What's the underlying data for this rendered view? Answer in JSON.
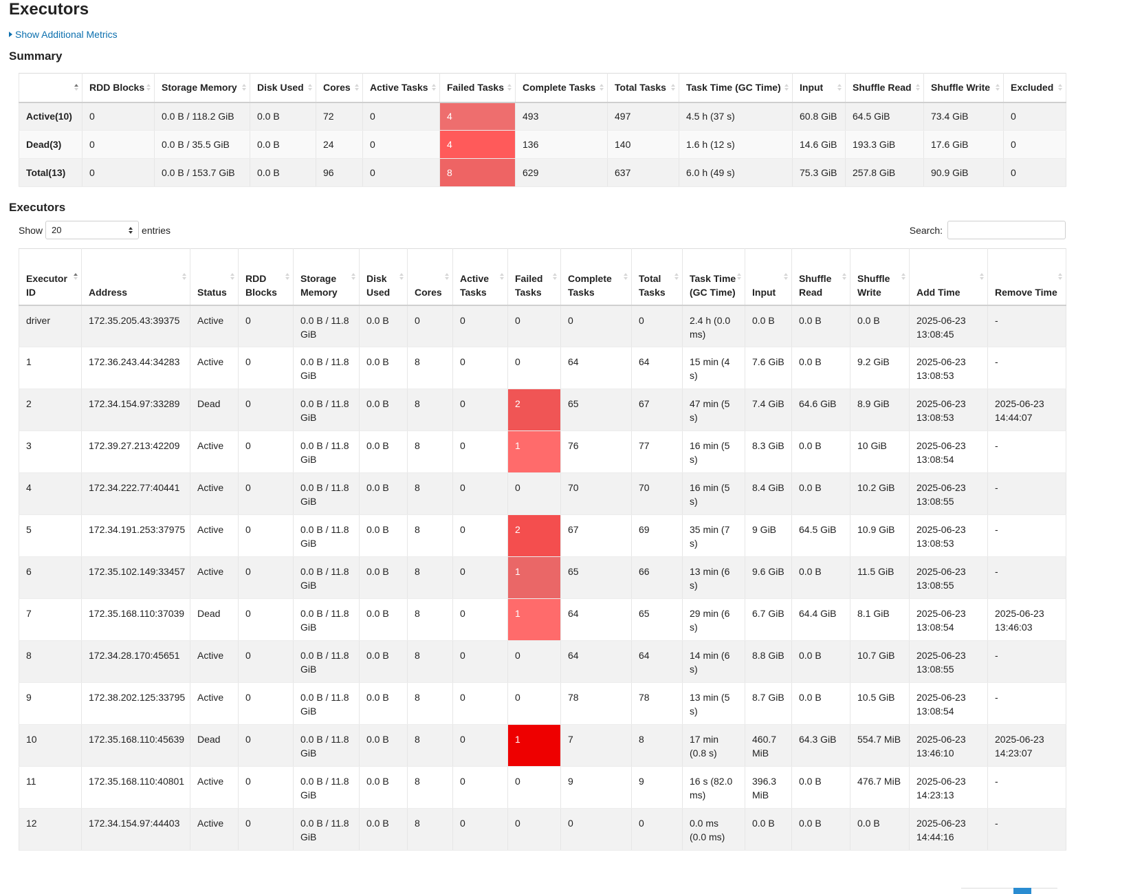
{
  "page": {
    "title": "Executors",
    "toggle_label": "Show Additional Metrics",
    "summary_title": "Summary",
    "executors_title": "Executors"
  },
  "summary": {
    "columns": [
      "",
      "RDD Blocks",
      "Storage Memory",
      "Disk Used",
      "Cores",
      "Active Tasks",
      "Failed Tasks",
      "Complete Tasks",
      "Total Tasks",
      "Task Time (GC Time)",
      "Input",
      "Shuffle Read",
      "Shuffle Write",
      "Excluded"
    ],
    "rows": [
      {
        "label": "Active(10)",
        "rdd": "0",
        "storage": "0.0 B / 118.2 GiB",
        "disk": "0.0 B",
        "cores": "72",
        "active": "0",
        "failed": "4",
        "failed_color": "#ee6e6e",
        "complete": "493",
        "total": "497",
        "task_time": "4.5 h (37 s)",
        "input": "60.8 GiB",
        "shuffle_read": "64.5 GiB",
        "shuffle_write": "73.4 GiB",
        "excluded": "0"
      },
      {
        "label": "Dead(3)",
        "rdd": "0",
        "storage": "0.0 B / 35.5 GiB",
        "disk": "0.0 B",
        "cores": "24",
        "active": "0",
        "failed": "4",
        "failed_color": "#ff5a5a",
        "complete": "136",
        "total": "140",
        "task_time": "1.6 h (12 s)",
        "input": "14.6 GiB",
        "shuffle_read": "193.3 GiB",
        "shuffle_write": "17.6 GiB",
        "excluded": "0"
      },
      {
        "label": "Total(13)",
        "rdd": "0",
        "storage": "0.0 B / 153.7 GiB",
        "disk": "0.0 B",
        "cores": "96",
        "active": "0",
        "failed": "8",
        "failed_color": "#ee6464",
        "complete": "629",
        "total": "637",
        "task_time": "6.0 h (49 s)",
        "input": "75.3 GiB",
        "shuffle_read": "257.8 GiB",
        "shuffle_write": "90.9 GiB",
        "excluded": "0"
      }
    ]
  },
  "controls": {
    "show_label": "Show",
    "entries_value": "20",
    "entries_label": "entries",
    "search_label": "Search:",
    "search_value": ""
  },
  "executors": {
    "columns": [
      "Executor ID",
      "Address",
      "Status",
      "RDD Blocks",
      "Storage Memory",
      "Disk Used",
      "Cores",
      "Active Tasks",
      "Failed Tasks",
      "Complete Tasks",
      "Total Tasks",
      "Task Time (GC Time)",
      "Input",
      "Shuffle Read",
      "Shuffle Write",
      "Add Time",
      "Remove Time"
    ],
    "rows": [
      {
        "id": "driver",
        "address": "172.35.205.43:39375",
        "status": "Active",
        "rdd": "0",
        "storage": "0.0 B / 11.8 GiB",
        "disk": "0.0 B",
        "cores": "0",
        "active": "0",
        "failed": "0",
        "failed_color": "",
        "complete": "0",
        "total": "0",
        "task_time": "2.4 h (0.0 ms)",
        "input": "0.0 B",
        "shuffle_read": "0.0 B",
        "shuffle_write": "0.0 B",
        "add_time": "2025-06-23 13:08:45",
        "remove_time": "-"
      },
      {
        "id": "1",
        "address": "172.36.243.44:34283",
        "status": "Active",
        "rdd": "0",
        "storage": "0.0 B / 11.8 GiB",
        "disk": "0.0 B",
        "cores": "8",
        "active": "0",
        "failed": "0",
        "failed_color": "",
        "complete": "64",
        "total": "64",
        "task_time": "15 min (4 s)",
        "input": "7.6 GiB",
        "shuffle_read": "0.0 B",
        "shuffle_write": "9.2 GiB",
        "add_time": "2025-06-23 13:08:53",
        "remove_time": "-"
      },
      {
        "id": "2",
        "address": "172.34.154.97:33289",
        "status": "Dead",
        "rdd": "0",
        "storage": "0.0 B / 11.8 GiB",
        "disk": "0.0 B",
        "cores": "8",
        "active": "0",
        "failed": "2",
        "failed_color": "#f05555",
        "complete": "65",
        "total": "67",
        "task_time": "47 min (5 s)",
        "input": "7.4 GiB",
        "shuffle_read": "64.6 GiB",
        "shuffle_write": "8.9 GiB",
        "add_time": "2025-06-23 13:08:53",
        "remove_time": "2025-06-23 14:44:07"
      },
      {
        "id": "3",
        "address": "172.39.27.213:42209",
        "status": "Active",
        "rdd": "0",
        "storage": "0.0 B / 11.8 GiB",
        "disk": "0.0 B",
        "cores": "8",
        "active": "0",
        "failed": "1",
        "failed_color": "#ff6b6b",
        "complete": "76",
        "total": "77",
        "task_time": "16 min (5 s)",
        "input": "8.3 GiB",
        "shuffle_read": "0.0 B",
        "shuffle_write": "10 GiB",
        "add_time": "2025-06-23 13:08:54",
        "remove_time": "-"
      },
      {
        "id": "4",
        "address": "172.34.222.77:40441",
        "status": "Active",
        "rdd": "0",
        "storage": "0.0 B / 11.8 GiB",
        "disk": "0.0 B",
        "cores": "8",
        "active": "0",
        "failed": "0",
        "failed_color": "",
        "complete": "70",
        "total": "70",
        "task_time": "16 min (5 s)",
        "input": "8.4 GiB",
        "shuffle_read": "0.0 B",
        "shuffle_write": "10.2 GiB",
        "add_time": "2025-06-23 13:08:55",
        "remove_time": "-"
      },
      {
        "id": "5",
        "address": "172.34.191.253:37975",
        "status": "Active",
        "rdd": "0",
        "storage": "0.0 B / 11.8 GiB",
        "disk": "0.0 B",
        "cores": "8",
        "active": "0",
        "failed": "2",
        "failed_color": "#f44e4e",
        "complete": "67",
        "total": "69",
        "task_time": "35 min (7 s)",
        "input": "9 GiB",
        "shuffle_read": "64.5 GiB",
        "shuffle_write": "10.9 GiB",
        "add_time": "2025-06-23 13:08:53",
        "remove_time": "-"
      },
      {
        "id": "6",
        "address": "172.35.102.149:33457",
        "status": "Active",
        "rdd": "0",
        "storage": "0.0 B / 11.8 GiB",
        "disk": "0.0 B",
        "cores": "8",
        "active": "0",
        "failed": "1",
        "failed_color": "#ea6767",
        "complete": "65",
        "total": "66",
        "task_time": "13 min (6 s)",
        "input": "9.6 GiB",
        "shuffle_read": "0.0 B",
        "shuffle_write": "11.5 GiB",
        "add_time": "2025-06-23 13:08:55",
        "remove_time": "-"
      },
      {
        "id": "7",
        "address": "172.35.168.110:37039",
        "status": "Dead",
        "rdd": "0",
        "storage": "0.0 B / 11.8 GiB",
        "disk": "0.0 B",
        "cores": "8",
        "active": "0",
        "failed": "1",
        "failed_color": "#ff6b6b",
        "complete": "64",
        "total": "65",
        "task_time": "29 min (6 s)",
        "input": "6.7 GiB",
        "shuffle_read": "64.4 GiB",
        "shuffle_write": "8.1 GiB",
        "add_time": "2025-06-23 13:08:54",
        "remove_time": "2025-06-23 13:46:03"
      },
      {
        "id": "8",
        "address": "172.34.28.170:45651",
        "status": "Active",
        "rdd": "0",
        "storage": "0.0 B / 11.8 GiB",
        "disk": "0.0 B",
        "cores": "8",
        "active": "0",
        "failed": "0",
        "failed_color": "",
        "complete": "64",
        "total": "64",
        "task_time": "14 min (6 s)",
        "input": "8.8 GiB",
        "shuffle_read": "0.0 B",
        "shuffle_write": "10.7 GiB",
        "add_time": "2025-06-23 13:08:55",
        "remove_time": "-"
      },
      {
        "id": "9",
        "address": "172.38.202.125:33795",
        "status": "Active",
        "rdd": "0",
        "storage": "0.0 B / 11.8 GiB",
        "disk": "0.0 B",
        "cores": "8",
        "active": "0",
        "failed": "0",
        "failed_color": "",
        "complete": "78",
        "total": "78",
        "task_time": "13 min (5 s)",
        "input": "8.7 GiB",
        "shuffle_read": "0.0 B",
        "shuffle_write": "10.5 GiB",
        "add_time": "2025-06-23 13:08:54",
        "remove_time": "-"
      },
      {
        "id": "10",
        "address": "172.35.168.110:45639",
        "status": "Dead",
        "rdd": "0",
        "storage": "0.0 B / 11.8 GiB",
        "disk": "0.0 B",
        "cores": "8",
        "active": "0",
        "failed": "1",
        "failed_color": "#ee0000",
        "complete": "7",
        "total": "8",
        "task_time": "17 min (0.8 s)",
        "input": "460.7 MiB",
        "shuffle_read": "64.3 GiB",
        "shuffle_write": "554.7 MiB",
        "add_time": "2025-06-23 13:46:10",
        "remove_time": "2025-06-23 14:23:07"
      },
      {
        "id": "11",
        "address": "172.35.168.110:40801",
        "status": "Active",
        "rdd": "0",
        "storage": "0.0 B / 11.8 GiB",
        "disk": "0.0 B",
        "cores": "8",
        "active": "0",
        "failed": "0",
        "failed_color": "",
        "complete": "9",
        "total": "9",
        "task_time": "16 s (82.0 ms)",
        "input": "396.3 MiB",
        "shuffle_read": "0.0 B",
        "shuffle_write": "476.7 MiB",
        "add_time": "2025-06-23 14:23:13",
        "remove_time": "-"
      },
      {
        "id": "12",
        "address": "172.34.154.97:44403",
        "status": "Active",
        "rdd": "0",
        "storage": "0.0 B / 11.8 GiB",
        "disk": "0.0 B",
        "cores": "8",
        "active": "0",
        "failed": "0",
        "failed_color": "",
        "complete": "0",
        "total": "0",
        "task_time": "0.0 ms (0.0 ms)",
        "input": "0.0 B",
        "shuffle_read": "0.0 B",
        "shuffle_write": "0.0 B",
        "add_time": "2025-06-23 14:44:16",
        "remove_time": "-"
      }
    ]
  }
}
